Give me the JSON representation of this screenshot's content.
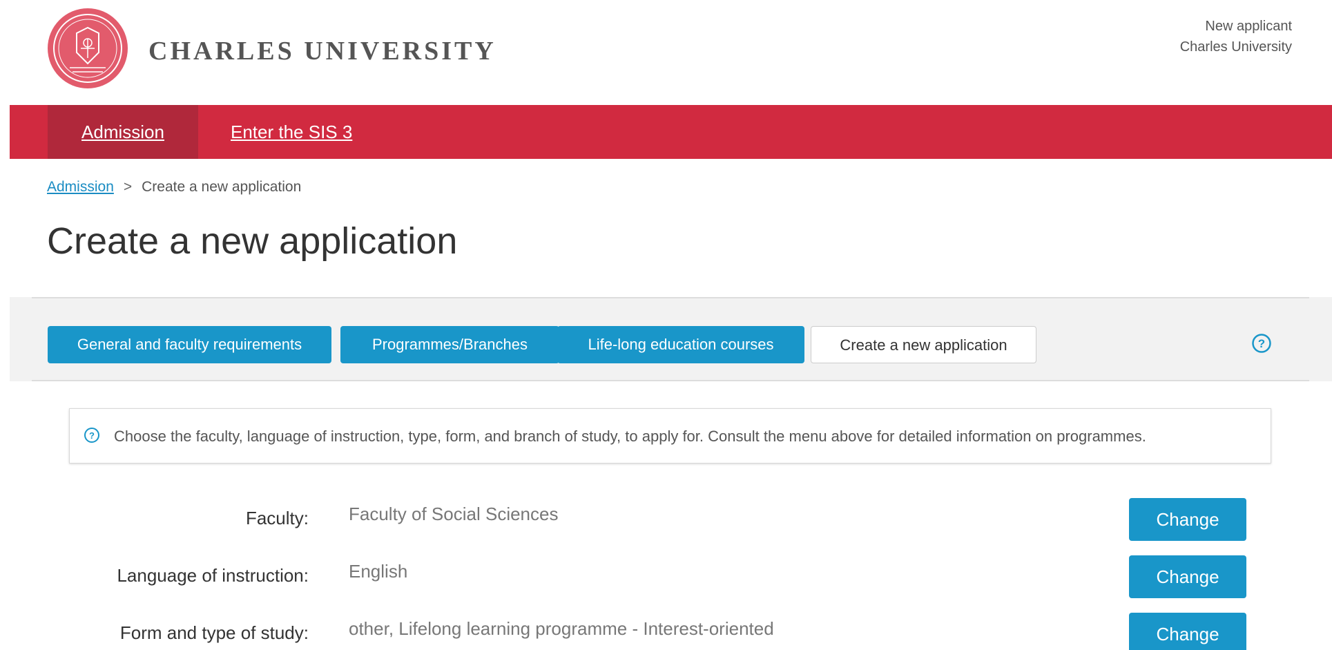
{
  "header": {
    "brand": "CHARLES UNIVERSITY",
    "user_line1": "New applicant",
    "user_line2": "Charles University",
    "logo_icon": "university-seal-icon",
    "accent_color": "#d12a40"
  },
  "nav": {
    "items": [
      {
        "label": "Admission",
        "active": true
      },
      {
        "label": "Enter the SIS 3",
        "active": false
      }
    ]
  },
  "breadcrumb": {
    "link": "Admission",
    "separator": ">",
    "current": "Create a new application"
  },
  "page_title": "Create a new application",
  "tabs": [
    {
      "label": "General and faculty requirements",
      "active": false
    },
    {
      "label": "Programmes/Branches",
      "active": false
    },
    {
      "label": "Life-long education courses",
      "active": false
    },
    {
      "label": "Create a new application",
      "active": true
    }
  ],
  "info": {
    "text": "Choose the faculty, language of instruction, type, form, and branch of study, to apply for. Consult the menu above for detailed information on programmes."
  },
  "form": {
    "rows": [
      {
        "label": "Faculty:",
        "value": "Faculty of Social Sciences",
        "button": "Change"
      },
      {
        "label": "Language of instruction:",
        "value": "English",
        "button": "Change"
      },
      {
        "label": "Form and type of study:",
        "value": "other, Lifelong learning programme - Interest-oriented",
        "button": "Change"
      }
    ]
  },
  "colors": {
    "primary_button": "#1996c9",
    "nav_active": "#b0283b"
  }
}
